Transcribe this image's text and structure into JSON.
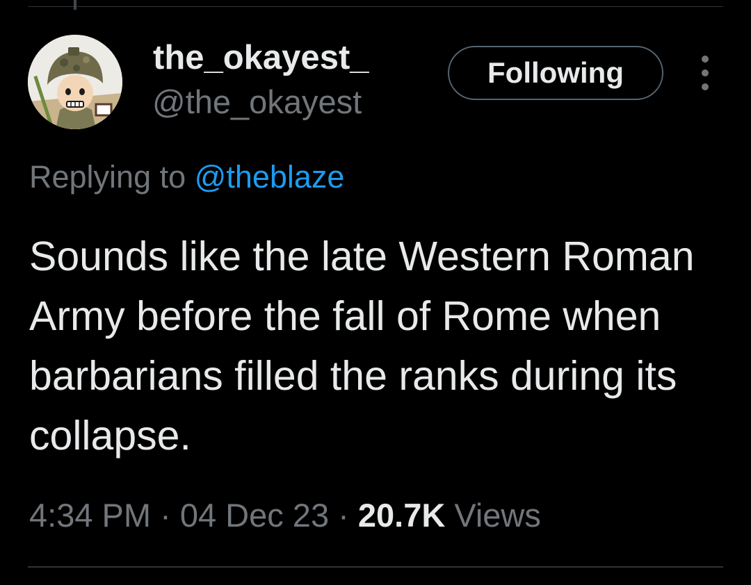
{
  "author": {
    "display_name": "the_okayest_",
    "handle": "@the_okayest",
    "avatar_icon": "cartoon-soldier-avatar"
  },
  "actions": {
    "follow_label": "Following",
    "more_icon": "more-vertical-icon"
  },
  "reply": {
    "prefix": "Replying to ",
    "mention": "@theblaze"
  },
  "tweet": {
    "text": "Sounds like the late Western Roman Army before the fall of Rome when barbarians filled the ranks during its collapse."
  },
  "meta": {
    "time": "4:34 PM",
    "separator": " · ",
    "date": "04 Dec 23",
    "views_count": "20.7K",
    "views_label": " Views"
  },
  "colors": {
    "background": "#000000",
    "primary_text": "#e7e9ea",
    "secondary_text": "#71767b",
    "link": "#1d9bf0",
    "divider": "#2f3336"
  }
}
